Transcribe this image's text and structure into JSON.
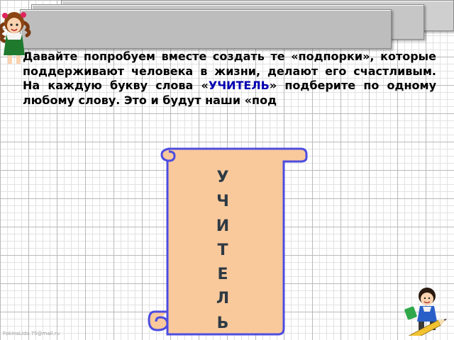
{
  "paragraph": {
    "part1": "Давайте попробуем вместе создать те «подпорки», которые поддерживают человека в жизни, делают его счастливым. На каждую букву слова «",
    "keyword": "УЧИТЕЛЬ",
    "part2": "» подберите по одному любому слову. Это и будут наши «под"
  },
  "scroll": {
    "letters": [
      "У",
      "Ч",
      "И",
      "Т",
      "Е",
      "Л",
      "Ь"
    ],
    "fill_color": "#f9c99c",
    "outline_color": "#4d4de0"
  },
  "keyword_color": "#0000b0",
  "watermark": "FokinaLida.75@mail.ru",
  "icons": {
    "top_left": "girl-with-pigtails-illustration-icon",
    "bottom_right": "schoolboy-with-pencil-illustration-icon"
  }
}
